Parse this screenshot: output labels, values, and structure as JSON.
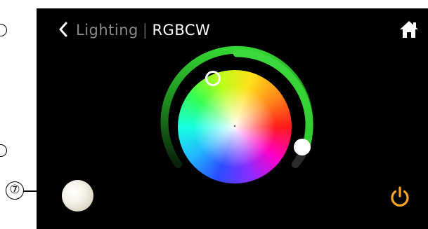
{
  "header": {
    "back_icon": "chevron-left-icon",
    "parent_label": "Lighting",
    "separator": "|",
    "current_label": "RGBCW",
    "home_icon": "home-icon"
  },
  "color_control": {
    "wheel": "rgb-color-wheel",
    "brightness_level": 0.8
  },
  "footer": {
    "power_icon": "power-icon",
    "power_color": "#f5a623"
  },
  "document": {
    "callout": "⑦"
  },
  "colors": {
    "background": "#000000",
    "brightness_track": "#2ecc2e",
    "title_parent": "#8a8a8a",
    "title_current": "#ffffff"
  }
}
